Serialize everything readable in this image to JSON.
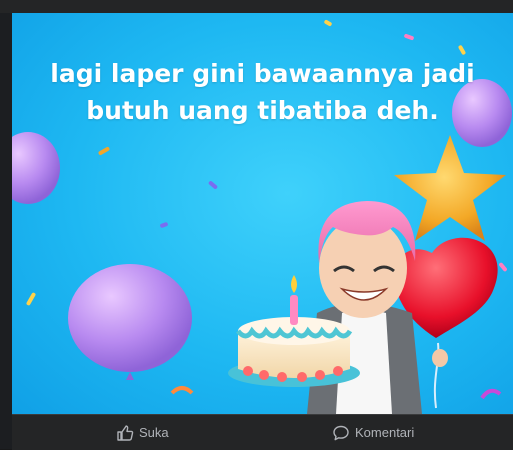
{
  "post": {
    "caption_line1": "lagi laper gini bawaannya jadi",
    "caption_line2": "butuh uang tibatiba deh."
  },
  "actions": {
    "like_label": "Suka",
    "comment_label": "Komentari"
  },
  "icons": {
    "like": "thumbs-up-icon",
    "comment": "speech-bubble-icon"
  },
  "colors": {
    "background_blue": "#1eb8f2",
    "text_muted": "#b0b3b8",
    "bar_background": "#242526"
  }
}
